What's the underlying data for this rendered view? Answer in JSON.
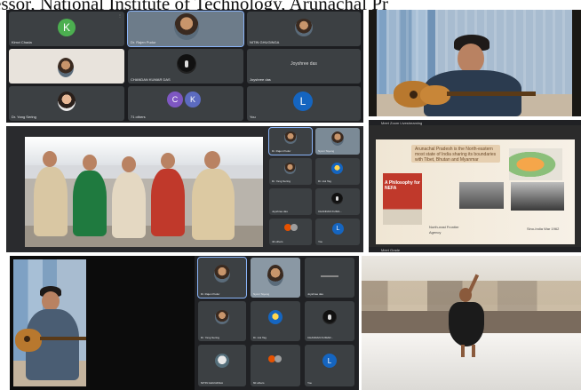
{
  "caption": "essor, National Institute of Technology, Arunachal Pr",
  "panel1": {
    "tiles": [
      {
        "name": "Kimvi Chada",
        "initial": "K",
        "color": "#4caf50"
      },
      {
        "name": "Dr. Rajen Pudur"
      },
      {
        "name": "NITIN GHUGINGA"
      },
      {
        "name": ""
      },
      {
        "name": "CHANDAN KUMAR DAS"
      },
      {
        "name": "Joyshree das",
        "center_text": "Joyshree das"
      },
      {
        "name": "Dr. Yang Sering"
      },
      {
        "name": "71 others",
        "initials": [
          "C",
          "K"
        ]
      },
      {
        "name": "You",
        "initial": "L",
        "color": "#1565c0"
      }
    ]
  },
  "panel3": {
    "tiles": [
      {
        "name": "Dr. Rajen Pudur"
      },
      {
        "name": "Nyoni Tayeng"
      },
      {
        "name": "Dr. Yang Sering"
      },
      {
        "name": "Dr. Hui Tag"
      },
      {
        "name": "Joyshree das"
      },
      {
        "name": "CHANDAN KUMA..."
      },
      {
        "name": "43 others"
      },
      {
        "name": "You",
        "initial": "L",
        "color": "#1565c0"
      }
    ]
  },
  "panel4": {
    "tab": "Meet Zoom Livestreaming",
    "slide": {
      "body": "Arunachal Pradesh is the North-eastern most state of India sharing its boundaries with Tibet, Bhutan and Myanmar",
      "book": "A Philosophy for NEFA",
      "caption1": "North-east Frontier Agency",
      "caption2": "Sino-India War 1962"
    },
    "bottom": "Meet Grade"
  },
  "panel6": {
    "tiles": [
      {
        "name": "Dr. Rajen Pudur"
      },
      {
        "name": "Nyoni Tayeng"
      },
      {
        "name": "Joyshree das"
      },
      {
        "name": "Dr. Yang Sering"
      },
      {
        "name": "Dr. Hui Tag"
      },
      {
        "name": "CHANDAN KUMAR..."
      },
      {
        "name": "NITIN GHUGINGA"
      },
      {
        "name": "60 others"
      },
      {
        "name": "You",
        "initial": "L",
        "color": "#1565c0"
      }
    ]
  }
}
